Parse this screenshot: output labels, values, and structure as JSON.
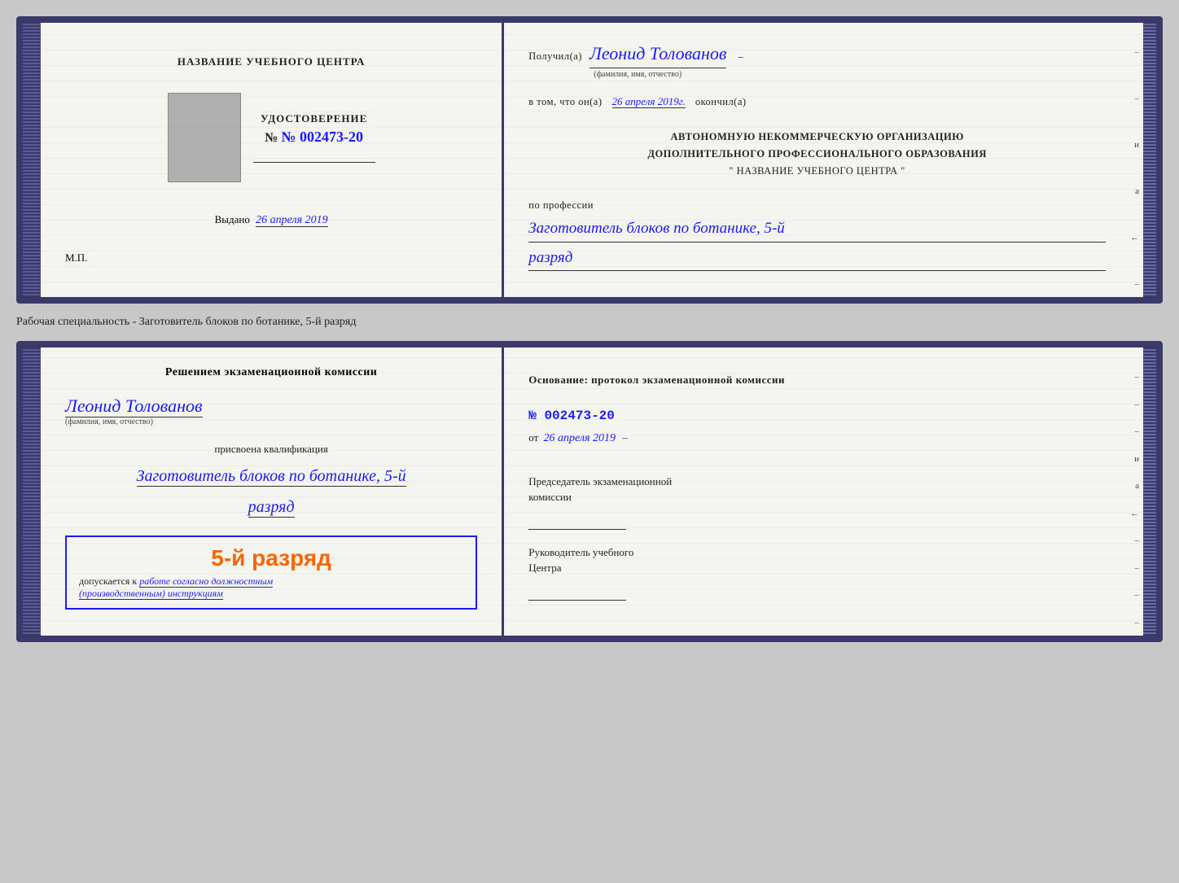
{
  "page": {
    "background": "#c8c8c8"
  },
  "specialty_label": "Рабочая специальность - Заготовитель блоков по ботанике, 5-й разряд",
  "top_cert": {
    "left": {
      "training_center_label": "НАЗВАНИЕ УЧЕБНОГО ЦЕНТРА",
      "udostoverenie_label": "УДОСТОВЕРЕНИЕ",
      "number_label": "№ 002473-20",
      "issued_label": "Выдано",
      "issued_date": "26 апреля 2019",
      "mp_label": "М.П."
    },
    "right": {
      "received_prefix": "Получил(а)",
      "recipient_name": "Леонид Толованов",
      "full_name_label": "(фамилия, имя, отчество)",
      "in_that_prefix": "в том, что он(а)",
      "date_handwritten": "26 апреля 2019г.",
      "finished_label": "окончил(а)",
      "org_line1": "АВТОНОМНУЮ НЕКОММЕРЧЕСКУЮ ОРГАНИЗАЦИЮ",
      "org_line2": "ДОПОЛНИТЕЛЬНОГО ПРОФЕССИОНАЛЬНОГО ОБРАЗОВАНИЯ",
      "org_quote": "\"  НАЗВАНИЕ УЧЕБНОГО ЦЕНТРА  \"",
      "profession_prefix": "по профессии",
      "profession_name": "Заготовитель блоков по ботанике, 5-й",
      "razryad": "разряд"
    }
  },
  "bottom_cert": {
    "left": {
      "decision_line1": "Решением экзаменационной комиссии",
      "recipient_name": "Леонид Толованов",
      "full_name_label": "(фамилия, имя, отчество)",
      "assigned_label": "присвоена квалификация",
      "qualification": "Заготовитель блоков по ботанике, 5-й",
      "razryad": "разряд",
      "big_rank": "5-й разряд",
      "allowed_prefix": "допускается к",
      "allowed_text1": "работе согласно должностным",
      "allowed_text2": "(производственным) инструкциям"
    },
    "right": {
      "basis_label": "Основание: протокол экзаменационной комиссии",
      "protocol_number": "№  002473-20",
      "from_label": "от",
      "from_date": "26 апреля 2019",
      "chairman_label1": "Председатель экзаменационной",
      "chairman_label2": "комиссии",
      "head_label1": "Руководитель учебного",
      "head_label2": "Центра"
    }
  },
  "right_edge_labels": [
    "–",
    "–",
    "и",
    "а",
    "←",
    "–",
    "–",
    "–",
    "–"
  ]
}
